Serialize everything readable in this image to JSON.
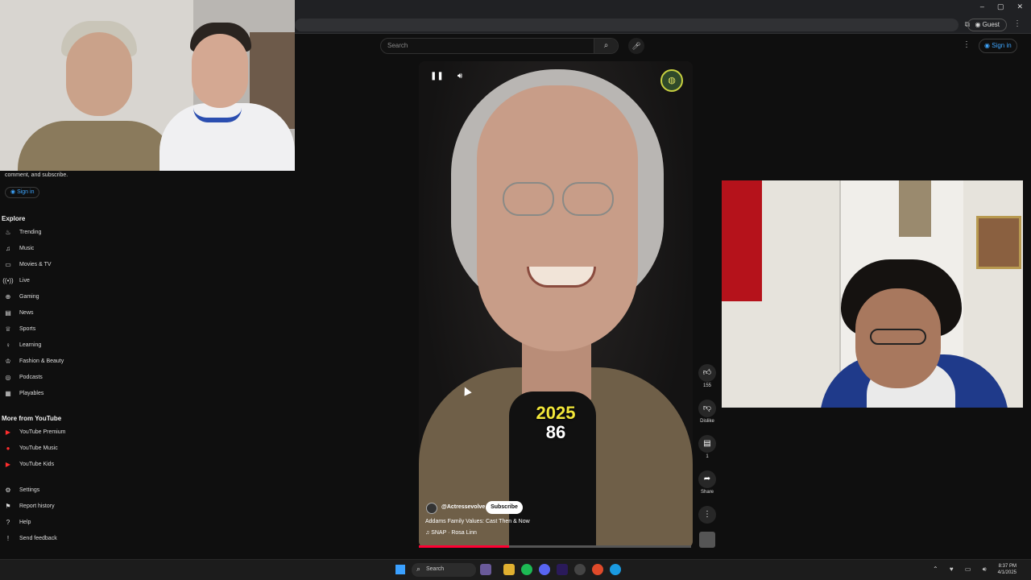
{
  "browser": {
    "guest_label": "Guest",
    "window_controls": [
      "–",
      "▢",
      "✕"
    ]
  },
  "youtube_header": {
    "search_placeholder": "Search",
    "signin_label": "Sign in"
  },
  "sidebar": {
    "subscribe_text": "comment, and subscribe.",
    "signin_label": "Sign in",
    "explore_title": "Explore",
    "explore_items": [
      {
        "label": "Trending",
        "icon": "trending-icon"
      },
      {
        "label": "Music",
        "icon": "music-icon"
      },
      {
        "label": "Movies & TV",
        "icon": "movies-icon"
      },
      {
        "label": "Live",
        "icon": "live-icon"
      },
      {
        "label": "Gaming",
        "icon": "gaming-icon"
      },
      {
        "label": "News",
        "icon": "news-icon"
      },
      {
        "label": "Sports",
        "icon": "sports-icon"
      },
      {
        "label": "Learning",
        "icon": "learning-icon"
      },
      {
        "label": "Fashion & Beauty",
        "icon": "fashion-icon"
      },
      {
        "label": "Podcasts",
        "icon": "podcasts-icon"
      },
      {
        "label": "Playables",
        "icon": "playables-icon"
      }
    ],
    "more_title": "More from YouTube",
    "more_items": [
      {
        "label": "YouTube Premium"
      },
      {
        "label": "YouTube Music"
      },
      {
        "label": "YouTube Kids"
      }
    ],
    "footer_items": [
      {
        "label": "Settings",
        "icon": "settings-icon"
      },
      {
        "label": "Report history",
        "icon": "flag-icon"
      },
      {
        "label": "Help",
        "icon": "help-icon"
      },
      {
        "label": "Send feedback",
        "icon": "feedback-icon"
      }
    ]
  },
  "short": {
    "overlay_year": "2025",
    "overlay_age": "86",
    "channel": "@Actressevolve",
    "subscribe_label": "Subscribe",
    "title": "Addams Family Values: Cast Then & Now",
    "music": "♫ SNAP · Rosa Linn",
    "progress_fraction": 0.33,
    "actions": {
      "like_count": "155",
      "dislike_label": "Dislike",
      "comment_count": "1",
      "share_label": "Share"
    }
  },
  "taskbar": {
    "search_label": "Search",
    "time": "8:37 PM",
    "date": "4/1/2025"
  },
  "colors": {
    "background": "#0f0f0f",
    "accent_blue": "#3ea6ff",
    "youtube_red": "#ff0033",
    "overlay_yellow": "#f2e73a"
  }
}
